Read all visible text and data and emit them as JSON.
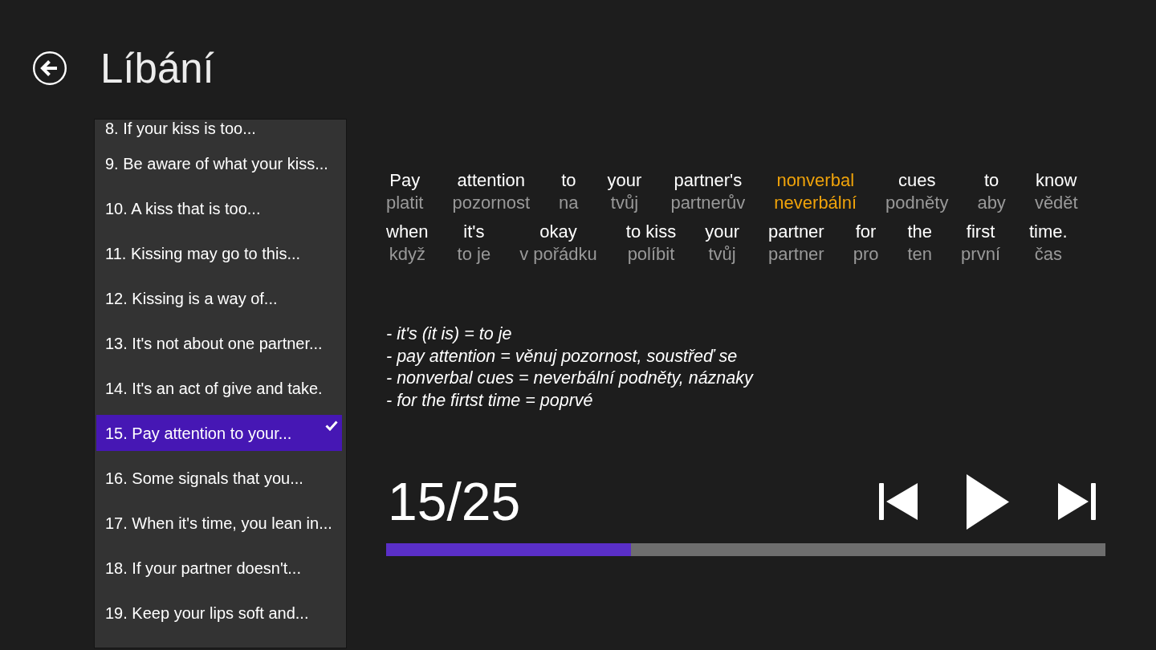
{
  "header": {
    "title": "Líbání"
  },
  "lesson_list": {
    "items": [
      {
        "label": "8. If your kiss is too...",
        "selected": false
      },
      {
        "label": "9. Be aware of what your kiss...",
        "selected": false
      },
      {
        "label": "10. A kiss that is too...",
        "selected": false
      },
      {
        "label": "11. Kissing may go to this...",
        "selected": false
      },
      {
        "label": "12. Kissing is a way of...",
        "selected": false
      },
      {
        "label": "13. It's not about one partner...",
        "selected": false
      },
      {
        "label": "14. It's an act of give and take.",
        "selected": false
      },
      {
        "label": "15. Pay attention to your...",
        "selected": true
      },
      {
        "label": "16. Some signals that you...",
        "selected": false
      },
      {
        "label": "17. When it's time, you lean in...",
        "selected": false
      },
      {
        "label": "18. If your partner doesn't...",
        "selected": false
      },
      {
        "label": "19. Keep your lips soft and...",
        "selected": false
      }
    ]
  },
  "sentence": {
    "lines": [
      [
        {
          "english": "Pay",
          "czech": "platit",
          "highlighted": false
        },
        {
          "english": "attention",
          "czech": "pozornost",
          "highlighted": false
        },
        {
          "english": "to",
          "czech": "na",
          "highlighted": false
        },
        {
          "english": "your",
          "czech": "tvůj",
          "highlighted": false
        },
        {
          "english": "partner's",
          "czech": "partnerův",
          "highlighted": false
        },
        {
          "english": "nonverbal",
          "czech": "neverbální",
          "highlighted": true
        },
        {
          "english": "cues",
          "czech": "podněty",
          "highlighted": false
        },
        {
          "english": "to",
          "czech": "aby",
          "highlighted": false
        },
        {
          "english": "know",
          "czech": "vědět",
          "highlighted": false
        }
      ],
      [
        {
          "english": "when",
          "czech": "když",
          "highlighted": false
        },
        {
          "english": "it's",
          "czech": "to je",
          "highlighted": false
        },
        {
          "english": "okay",
          "czech": "v pořádku",
          "highlighted": false
        },
        {
          "english": "to kiss",
          "czech": "políbit",
          "highlighted": false
        },
        {
          "english": "your",
          "czech": "tvůj",
          "highlighted": false
        },
        {
          "english": "partner",
          "czech": "partner",
          "highlighted": false
        },
        {
          "english": "for",
          "czech": "pro",
          "highlighted": false
        },
        {
          "english": "the",
          "czech": "ten",
          "highlighted": false
        },
        {
          "english": "first",
          "czech": "první",
          "highlighted": false
        },
        {
          "english": "time.",
          "czech": "čas",
          "highlighted": false
        }
      ]
    ]
  },
  "notes": [
    "- it's (it is) = to je",
    "- pay attention = věnuj pozornost, soustřeď se",
    "- nonverbal cues = neverbální podněty, náznaky",
    "- for the firtst time = poprvé"
  ],
  "player": {
    "counter": "15/25",
    "playing": false,
    "progress": {
      "level": 0.34
    }
  }
}
